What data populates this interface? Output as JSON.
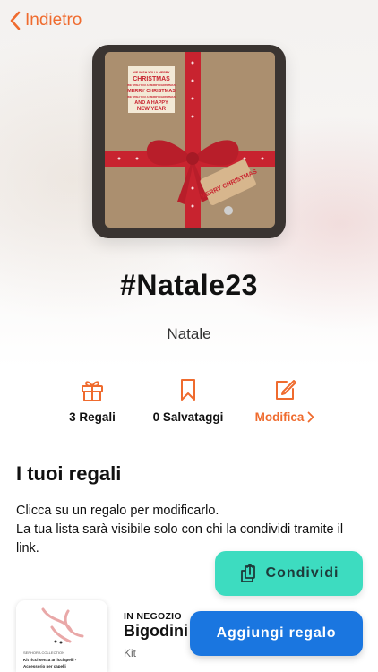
{
  "nav": {
    "back_label": "Indietro"
  },
  "list": {
    "title": "#Natale23",
    "subtitle": "Natale"
  },
  "stats": {
    "gifts_label": "3 Regali",
    "saved_label": "0 Salvataggi",
    "edit_label": "Modifica"
  },
  "section": {
    "title": "I tuoi regali",
    "description_line1": "Clicca su un regalo per modificarlo.",
    "description_line2": "La tua lista sarà visibile solo con chi la condividi tramite il link."
  },
  "gift_card": {
    "tag": "IN NEGOZIO",
    "name": "Bigodini",
    "category": "Kit",
    "thumb_brand": "SEPHORA COLLECTION",
    "thumb_text": "Kit ricci senza arricciapelli - Accessorio per capelli"
  },
  "cover_tag": {
    "lines": [
      "WE WISH YOU A MERRY",
      "CHRISTMAS",
      "WE WISH YOU A MERRY CHRISTMAS",
      "MERRY CHRISTMAS",
      "WE WISH YOU A MERRY CHRISTMAS",
      "AND A HAPPY",
      "NEW YEAR"
    ],
    "label_text": "MERRY CHRISTMAS"
  },
  "buttons": {
    "share_label": "Condividi",
    "add_label": "Aggiungi regalo"
  },
  "colors": {
    "accent": "#ef6b2e",
    "share_bg": "#3ddcc0",
    "add_bg": "#1a76e0"
  },
  "icons": {
    "back": "chevron-left-icon",
    "gifts": "gift-icon",
    "saved": "bookmark-icon",
    "edit": "edit-icon",
    "share": "share-icon"
  }
}
